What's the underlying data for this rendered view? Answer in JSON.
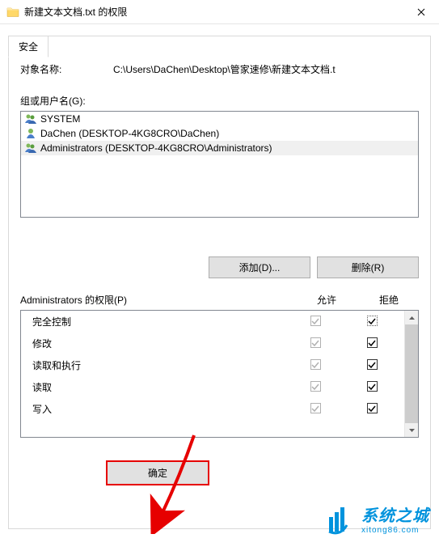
{
  "titlebar": {
    "text": "新建文本文档.txt 的权限"
  },
  "tab": {
    "label": "安全"
  },
  "object": {
    "label": "对象名称:",
    "path": "C:\\Users\\DaChen\\Desktop\\管家速修\\新建文本文档.t"
  },
  "groups": {
    "label": "组或用户名(G):",
    "items": [
      {
        "name": "SYSTEM",
        "icon": "group",
        "selected": false
      },
      {
        "name": "DaChen (DESKTOP-4KG8CRO\\DaChen)",
        "icon": "user",
        "selected": false
      },
      {
        "name": "Administrators (DESKTOP-4KG8CRO\\Administrators)",
        "icon": "group",
        "selected": true
      }
    ]
  },
  "buttons": {
    "add": "添加(D)...",
    "remove": "删除(R)",
    "ok": "确定"
  },
  "permissions": {
    "header_label": "Administrators 的权限(P)",
    "allow_label": "允许",
    "deny_label": "拒绝",
    "items": [
      {
        "name": "完全控制",
        "allow": true,
        "deny": true,
        "deny_dotted": true
      },
      {
        "name": "修改",
        "allow": true,
        "deny": true
      },
      {
        "name": "读取和执行",
        "allow": true,
        "deny": true
      },
      {
        "name": "读取",
        "allow": true,
        "deny": true
      },
      {
        "name": "写入",
        "allow": true,
        "deny": true
      }
    ]
  },
  "watermark": {
    "cn": "系统之城",
    "en": "xitong86.com"
  }
}
